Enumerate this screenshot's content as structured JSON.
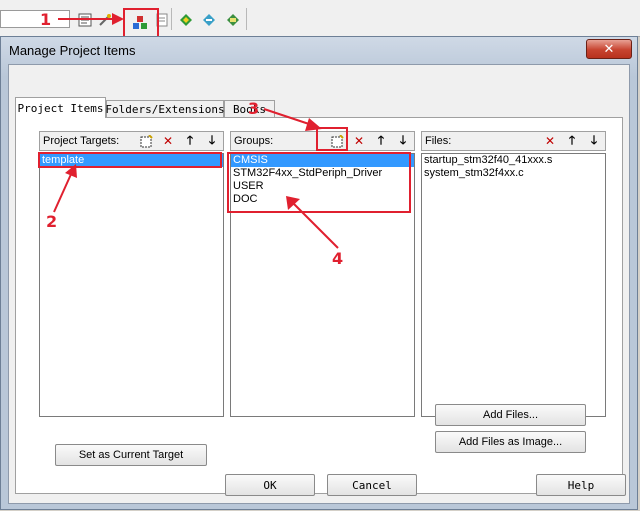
{
  "dialog": {
    "title": "Manage Project Items",
    "close_label": "✕"
  },
  "tabs": [
    {
      "label": "Project Items"
    },
    {
      "label": "Folders/Extensions"
    },
    {
      "label": "Books"
    }
  ],
  "project_targets": {
    "title": "Project Targets:",
    "items": [
      "template"
    ]
  },
  "groups": {
    "title": "Groups:",
    "items": [
      "CMSIS",
      "STM32F4xx_StdPeriph_Driver",
      "USER",
      "DOC"
    ]
  },
  "files": {
    "title": "Files:",
    "items": [
      "startup_stm32f40_41xxx.s",
      "system_stm32f4xx.c"
    ]
  },
  "buttons": {
    "set_target": "Set as Current Target",
    "add_files": "Add Files...",
    "add_files_image": "Add Files as Image...",
    "ok": "OK",
    "cancel": "Cancel",
    "help": "Help"
  },
  "annotations": [
    "1",
    "2",
    "3",
    "4"
  ],
  "colors": {
    "annotation_red": "#e0202f",
    "selection_blue": "#3399ff"
  }
}
